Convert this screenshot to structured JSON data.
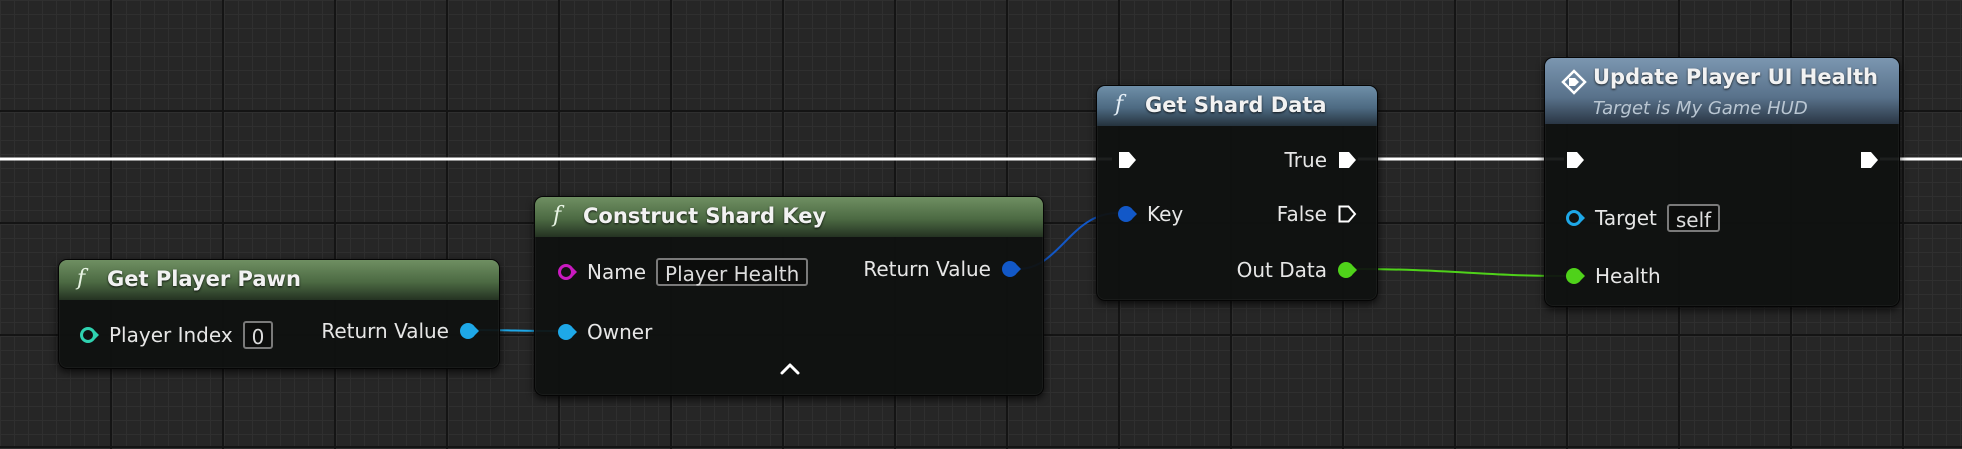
{
  "colors": {
    "exec": "#ffffff",
    "object": "#1ea8e8",
    "struct": "#1258c8",
    "name": "#c91ac0",
    "integer": "#2fd2b0",
    "float": "#4fd21a",
    "green_header": "#4c6a43",
    "blue_header": "#4d6a82"
  },
  "nodes": {
    "get_player_pawn": {
      "icon": "f",
      "title": "Get Player Pawn",
      "input_label": "Player Index",
      "input_value": "0",
      "output_label": "Return Value"
    },
    "construct_shard_key": {
      "icon": "f",
      "title": "Construct Shard Key",
      "name_label": "Name",
      "name_value": "Player Health",
      "owner_label": "Owner",
      "output_label": "Return Value",
      "collapse_icon": "chevron-up-icon"
    },
    "get_shard_data": {
      "icon": "f",
      "title": "Get Shard Data",
      "key_label": "Key",
      "true_label": "True",
      "false_label": "False",
      "out_data_label": "Out Data"
    },
    "update_player_ui_health": {
      "icon": "event-diamond-icon",
      "title": "Update Player UI Health",
      "subtitle": "Target is My Game HUD",
      "target_label": "Target",
      "target_value": "self",
      "health_label": "Health"
    }
  }
}
